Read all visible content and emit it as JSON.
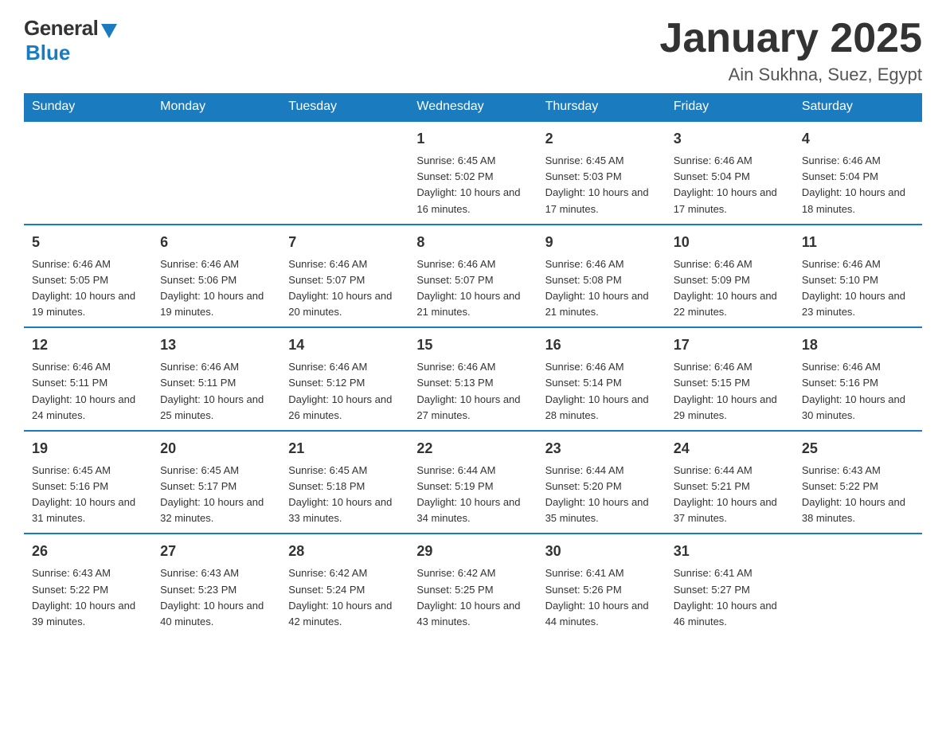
{
  "logo": {
    "general": "General",
    "blue": "Blue"
  },
  "title": {
    "month": "January 2025",
    "location": "Ain Sukhna, Suez, Egypt"
  },
  "weekdays": [
    "Sunday",
    "Monday",
    "Tuesday",
    "Wednesday",
    "Thursday",
    "Friday",
    "Saturday"
  ],
  "weeks": [
    [
      {
        "day": "",
        "info": ""
      },
      {
        "day": "",
        "info": ""
      },
      {
        "day": "",
        "info": ""
      },
      {
        "day": "1",
        "info": "Sunrise: 6:45 AM\nSunset: 5:02 PM\nDaylight: 10 hours\nand 16 minutes."
      },
      {
        "day": "2",
        "info": "Sunrise: 6:45 AM\nSunset: 5:03 PM\nDaylight: 10 hours\nand 17 minutes."
      },
      {
        "day": "3",
        "info": "Sunrise: 6:46 AM\nSunset: 5:04 PM\nDaylight: 10 hours\nand 17 minutes."
      },
      {
        "day": "4",
        "info": "Sunrise: 6:46 AM\nSunset: 5:04 PM\nDaylight: 10 hours\nand 18 minutes."
      }
    ],
    [
      {
        "day": "5",
        "info": "Sunrise: 6:46 AM\nSunset: 5:05 PM\nDaylight: 10 hours\nand 19 minutes."
      },
      {
        "day": "6",
        "info": "Sunrise: 6:46 AM\nSunset: 5:06 PM\nDaylight: 10 hours\nand 19 minutes."
      },
      {
        "day": "7",
        "info": "Sunrise: 6:46 AM\nSunset: 5:07 PM\nDaylight: 10 hours\nand 20 minutes."
      },
      {
        "day": "8",
        "info": "Sunrise: 6:46 AM\nSunset: 5:07 PM\nDaylight: 10 hours\nand 21 minutes."
      },
      {
        "day": "9",
        "info": "Sunrise: 6:46 AM\nSunset: 5:08 PM\nDaylight: 10 hours\nand 21 minutes."
      },
      {
        "day": "10",
        "info": "Sunrise: 6:46 AM\nSunset: 5:09 PM\nDaylight: 10 hours\nand 22 minutes."
      },
      {
        "day": "11",
        "info": "Sunrise: 6:46 AM\nSunset: 5:10 PM\nDaylight: 10 hours\nand 23 minutes."
      }
    ],
    [
      {
        "day": "12",
        "info": "Sunrise: 6:46 AM\nSunset: 5:11 PM\nDaylight: 10 hours\nand 24 minutes."
      },
      {
        "day": "13",
        "info": "Sunrise: 6:46 AM\nSunset: 5:11 PM\nDaylight: 10 hours\nand 25 minutes."
      },
      {
        "day": "14",
        "info": "Sunrise: 6:46 AM\nSunset: 5:12 PM\nDaylight: 10 hours\nand 26 minutes."
      },
      {
        "day": "15",
        "info": "Sunrise: 6:46 AM\nSunset: 5:13 PM\nDaylight: 10 hours\nand 27 minutes."
      },
      {
        "day": "16",
        "info": "Sunrise: 6:46 AM\nSunset: 5:14 PM\nDaylight: 10 hours\nand 28 minutes."
      },
      {
        "day": "17",
        "info": "Sunrise: 6:46 AM\nSunset: 5:15 PM\nDaylight: 10 hours\nand 29 minutes."
      },
      {
        "day": "18",
        "info": "Sunrise: 6:46 AM\nSunset: 5:16 PM\nDaylight: 10 hours\nand 30 minutes."
      }
    ],
    [
      {
        "day": "19",
        "info": "Sunrise: 6:45 AM\nSunset: 5:16 PM\nDaylight: 10 hours\nand 31 minutes."
      },
      {
        "day": "20",
        "info": "Sunrise: 6:45 AM\nSunset: 5:17 PM\nDaylight: 10 hours\nand 32 minutes."
      },
      {
        "day": "21",
        "info": "Sunrise: 6:45 AM\nSunset: 5:18 PM\nDaylight: 10 hours\nand 33 minutes."
      },
      {
        "day": "22",
        "info": "Sunrise: 6:44 AM\nSunset: 5:19 PM\nDaylight: 10 hours\nand 34 minutes."
      },
      {
        "day": "23",
        "info": "Sunrise: 6:44 AM\nSunset: 5:20 PM\nDaylight: 10 hours\nand 35 minutes."
      },
      {
        "day": "24",
        "info": "Sunrise: 6:44 AM\nSunset: 5:21 PM\nDaylight: 10 hours\nand 37 minutes."
      },
      {
        "day": "25",
        "info": "Sunrise: 6:43 AM\nSunset: 5:22 PM\nDaylight: 10 hours\nand 38 minutes."
      }
    ],
    [
      {
        "day": "26",
        "info": "Sunrise: 6:43 AM\nSunset: 5:22 PM\nDaylight: 10 hours\nand 39 minutes."
      },
      {
        "day": "27",
        "info": "Sunrise: 6:43 AM\nSunset: 5:23 PM\nDaylight: 10 hours\nand 40 minutes."
      },
      {
        "day": "28",
        "info": "Sunrise: 6:42 AM\nSunset: 5:24 PM\nDaylight: 10 hours\nand 42 minutes."
      },
      {
        "day": "29",
        "info": "Sunrise: 6:42 AM\nSunset: 5:25 PM\nDaylight: 10 hours\nand 43 minutes."
      },
      {
        "day": "30",
        "info": "Sunrise: 6:41 AM\nSunset: 5:26 PM\nDaylight: 10 hours\nand 44 minutes."
      },
      {
        "day": "31",
        "info": "Sunrise: 6:41 AM\nSunset: 5:27 PM\nDaylight: 10 hours\nand 46 minutes."
      },
      {
        "day": "",
        "info": ""
      }
    ]
  ]
}
